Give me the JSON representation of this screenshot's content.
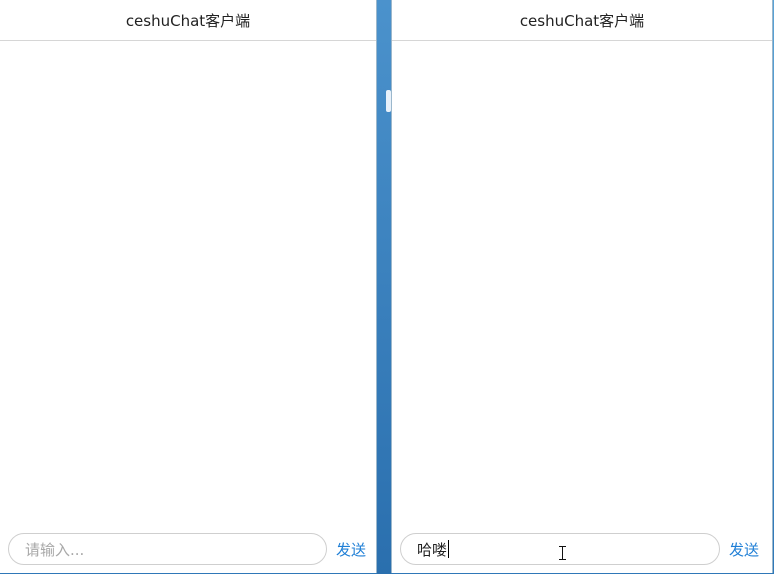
{
  "left_window": {
    "title": "ceshuChat客户端",
    "input": {
      "value": "",
      "placeholder": "请输入..."
    },
    "send_label": "发送"
  },
  "right_window": {
    "title": "ceshuChat客户端",
    "input": {
      "value": "哈喽",
      "placeholder": ""
    },
    "send_label": "发送"
  },
  "colors": {
    "send_link": "#1f7fd6",
    "desktop": "#3f8cc8"
  },
  "icons": [
    "text-cursor-icon"
  ]
}
